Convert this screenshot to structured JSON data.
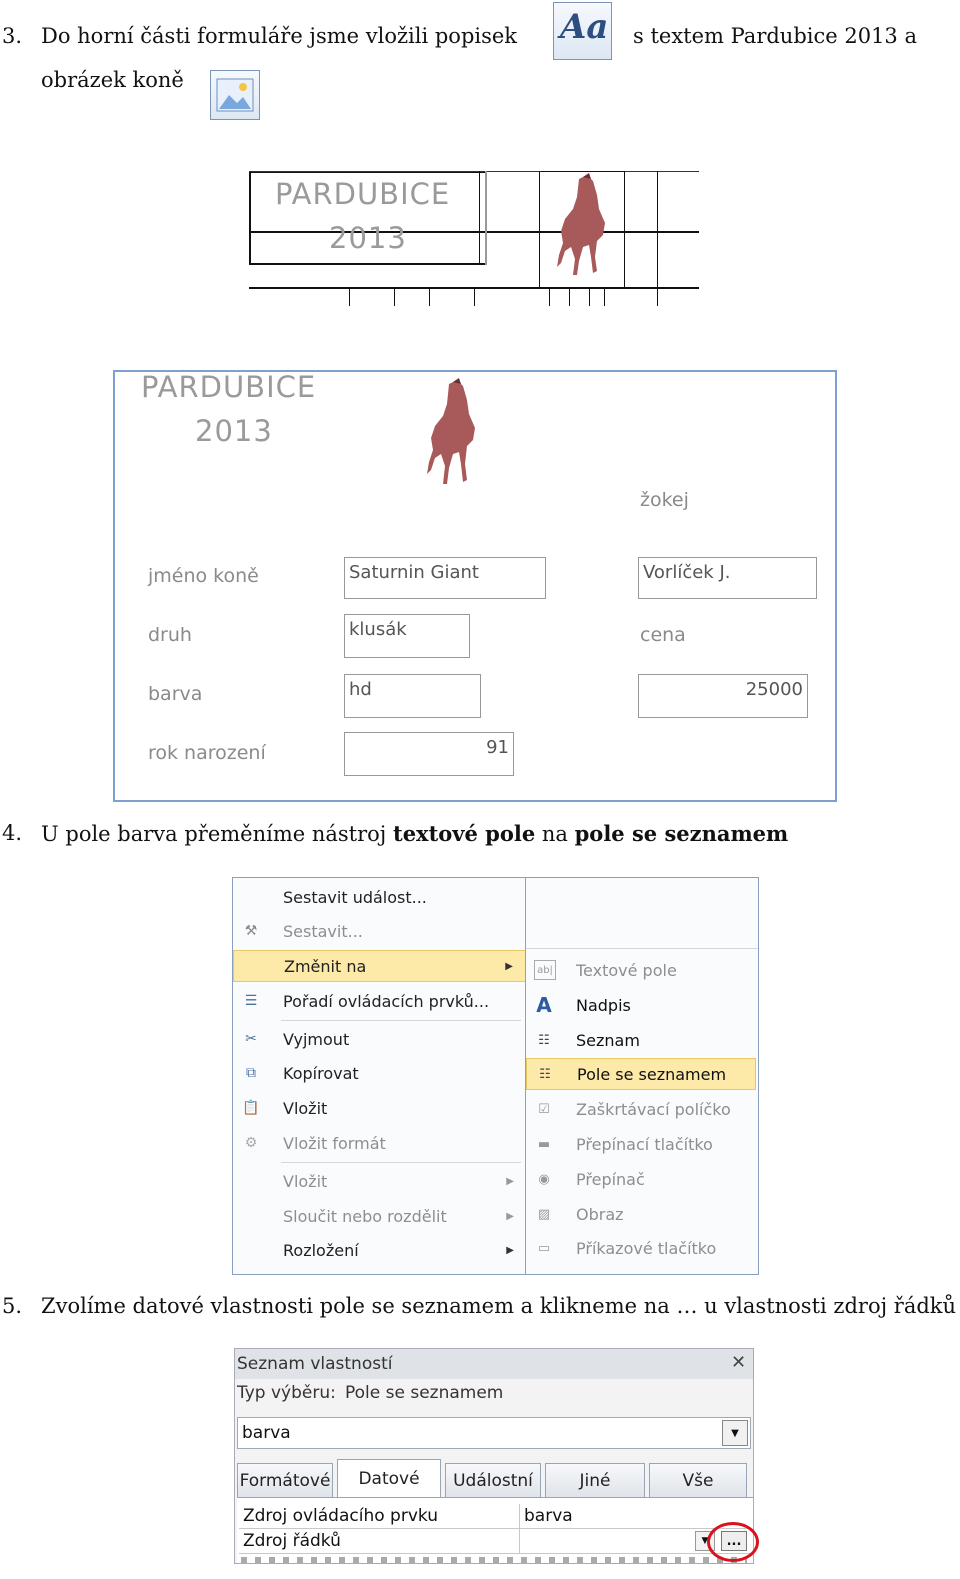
{
  "step3": {
    "number": "3.",
    "text_a": "Do horní části formuláře jsme vložili popisek",
    "text_b": "s textem Pardubice 2013 a",
    "text_c": "obrázek koně",
    "label_icon": "Aa"
  },
  "design_view": {
    "title_line1": "PARDUBICE",
    "title_line2": "2013"
  },
  "form": {
    "title_line1": "PARDUBICE",
    "title_line2": "2013",
    "labels": {
      "jockey": "žokej",
      "horse_name": "jméno koně",
      "breed": "druh",
      "price": "cena",
      "color": "barva",
      "birth_year": "rok narození"
    },
    "values": {
      "horse_name": "Saturnin Giant",
      "jockey": "Vorlíček J.",
      "breed": "klusák",
      "color": "hd",
      "price": "25000",
      "birth_year": "91"
    }
  },
  "step4": {
    "number": "4.",
    "text_a": "U pole barva přeměníme nástroj",
    "bold_a": "textové pole",
    "text_b": "na",
    "bold_b": "pole se seznamem"
  },
  "context_menu": {
    "items": [
      {
        "label": "Sestavit událost...",
        "icon": "none",
        "disabled": false
      },
      {
        "label": "Sestavit...",
        "icon": "wand-icon",
        "disabled": true
      },
      {
        "label": "Změnit na",
        "icon": "none",
        "disabled": false,
        "highlight": true,
        "submenu": true
      },
      {
        "label": "Pořadí ovládacích prvků...",
        "icon": "tab-order-icon",
        "disabled": false
      },
      {
        "label": "Vyjmout",
        "icon": "scissors-icon",
        "disabled": false
      },
      {
        "label": "Kopírovat",
        "icon": "copy-icon",
        "disabled": false
      },
      {
        "label": "Vložit",
        "icon": "paste-icon",
        "disabled": false
      },
      {
        "label": "Vložit formát",
        "icon": "paste-format-icon",
        "disabled": true
      },
      {
        "label": "Vložit",
        "icon": "none",
        "disabled": true,
        "submenu": true
      },
      {
        "label": "Sloučit nebo rozdělit",
        "icon": "none",
        "disabled": true,
        "submenu": true
      },
      {
        "label": "Rozložení",
        "icon": "none",
        "disabled": false,
        "submenu": true
      }
    ],
    "submenu": [
      {
        "label": "Textové pole",
        "icon": "ab|",
        "disabled": true
      },
      {
        "label": "Nadpis",
        "icon": "A",
        "disabled": false
      },
      {
        "label": "Seznam",
        "icon": "listbox-icon",
        "disabled": false
      },
      {
        "label": "Pole se seznamem",
        "icon": "combobox-icon",
        "disabled": false,
        "highlight": true
      },
      {
        "label": "Zaškrtávací políčko",
        "icon": "checkbox-icon",
        "disabled": true
      },
      {
        "label": "Přepínací tlačítko",
        "icon": "toggle-icon",
        "disabled": true
      },
      {
        "label": "Přepínač",
        "icon": "radio-icon",
        "disabled": true
      },
      {
        "label": "Obraz",
        "icon": "image-icon",
        "disabled": true
      },
      {
        "label": "Příkazové tlačítko",
        "icon": "command-button-icon",
        "disabled": true
      }
    ]
  },
  "step5": {
    "number": "5.",
    "text": "Zvolíme datové vlastnosti pole se seznamem a klikneme na … u vlastnosti zdroj řádků"
  },
  "property_sheet": {
    "title": "Seznam vlastností",
    "close": "✕",
    "selection_type_label": "Typ výběru:",
    "selection_type_value": "Pole se seznamem",
    "object": "barva",
    "tabs": [
      "Formátové",
      "Datové",
      "Událostní",
      "Jiné",
      "Vše"
    ],
    "active_tab": "Datové",
    "rows": [
      {
        "key": "Zdroj ovládacího prvku",
        "value": "barva"
      },
      {
        "key": "Zdroj řádků",
        "value": ""
      }
    ],
    "builder_button": "...",
    "highlight_color": "#d9121f"
  },
  "colors": {
    "form_border": "#7f9fcf",
    "menu_highlight": "#fde9a8",
    "label_gray": "#8a8a8a"
  }
}
